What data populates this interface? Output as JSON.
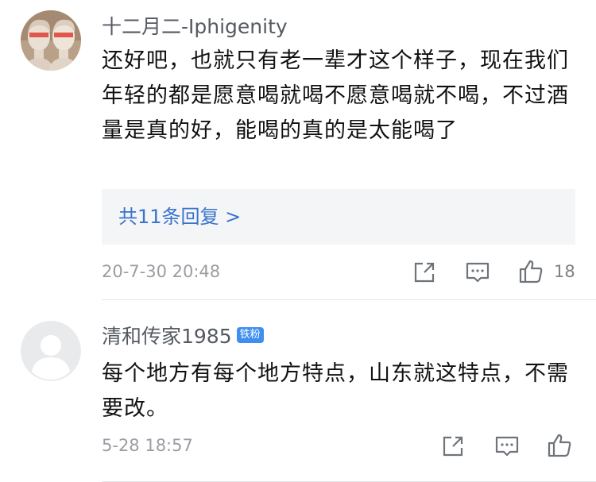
{
  "comments": [
    {
      "username": "十二月二-Iphigenity",
      "content": "还好吧，也就只有老一辈才这个样子，现在我们年轻的都是愿意喝就喝不愿意喝就不喝，不过酒量是真的好，能喝的真的是太能喝了",
      "replies_link": "共11条回复 >",
      "timestamp": "20-7-30 20:48",
      "like_count": "18",
      "avatar_icon": "statue-pair-avatar"
    },
    {
      "username": "清和传家1985",
      "badge": "铁粉",
      "content": "每个地方有每个地方特点，山东就这特点，不需要改。",
      "timestamp": "5-28 18:57",
      "avatar_icon": "default-user-avatar"
    }
  ],
  "colors": {
    "link": "#3a73c9",
    "badge": "#3f8ff0",
    "meta": "#9a9da3",
    "icon": "#6f737a"
  },
  "icons": {
    "share": "share-icon",
    "reply": "comment-icon",
    "like": "thumbs-up-icon"
  }
}
